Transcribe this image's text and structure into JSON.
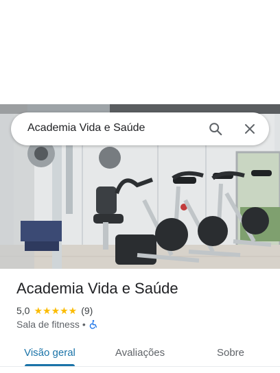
{
  "search": {
    "query": "Academia Vida e Saúde",
    "search_icon": "search-icon",
    "close_icon": "close-icon"
  },
  "place": {
    "name": "Academia Vida e Saúde",
    "rating": "5,0",
    "stars": 5,
    "stars_text": "★★★★★",
    "review_count": "(9)",
    "category": "Sala de fitness",
    "separator": "•",
    "accessibility_icon": "wheelchair-icon"
  },
  "tabs": [
    {
      "label": "Visão geral",
      "active": true
    },
    {
      "label": "Avaliações",
      "active": false
    },
    {
      "label": "Sobre",
      "active": false
    }
  ],
  "colors": {
    "accent": "#1a73a8",
    "star": "#fbbc04",
    "text_primary": "#202124",
    "text_secondary": "#5f6368"
  }
}
